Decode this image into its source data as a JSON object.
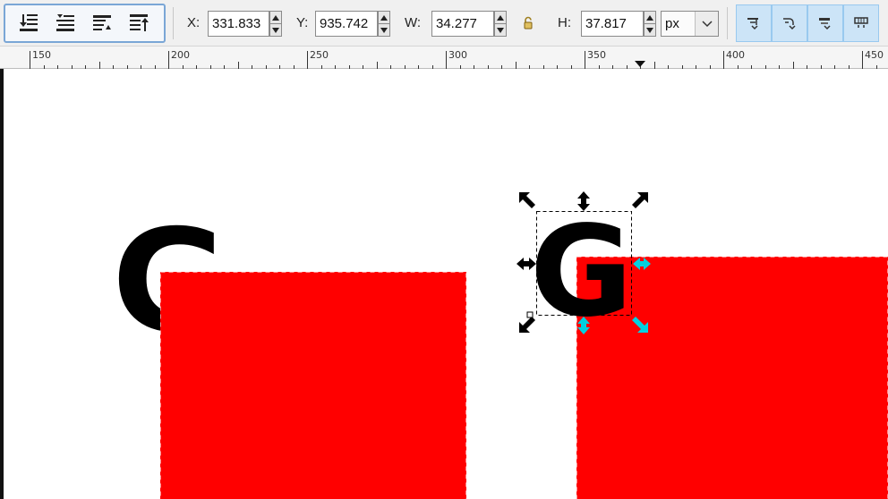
{
  "toolbar": {
    "zorder_buttons": [
      "lower-to-bottom",
      "lower",
      "raise",
      "raise-to-top"
    ],
    "x": {
      "label": "X:",
      "value": "331.833"
    },
    "y": {
      "label": "Y:",
      "value": "935.742"
    },
    "w": {
      "label": "W:",
      "value": "34.277"
    },
    "h": {
      "label": "H:",
      "value": "37.817"
    },
    "unit": "px",
    "transform_toggles": [
      "scale-stroke",
      "scale-rounded-corners",
      "move-gradients",
      "move-patterns"
    ]
  },
  "ruler": {
    "labels": [
      "150",
      "200",
      "250",
      "300",
      "350",
      "400",
      "450"
    ]
  },
  "canvas": {
    "left_glyph": "G",
    "right_glyph": "G",
    "text_color": "#000000",
    "rect_color": "#ff0000",
    "selection_handle_color": "#000000",
    "accent_handle_color": "#00d0e0"
  }
}
